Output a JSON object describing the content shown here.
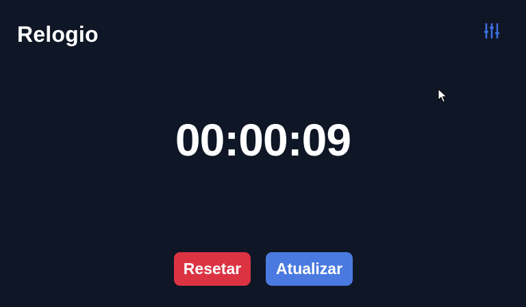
{
  "header": {
    "title": "Relogio",
    "settings_icon": "sliders-icon",
    "accent_color": "#3d6fe0"
  },
  "timer": {
    "display": "00:00:09"
  },
  "actions": {
    "reset_label": "Resetar",
    "reset_color": "#dc3343",
    "update_label": "Atualizar",
    "update_color": "#4a7ae0"
  }
}
